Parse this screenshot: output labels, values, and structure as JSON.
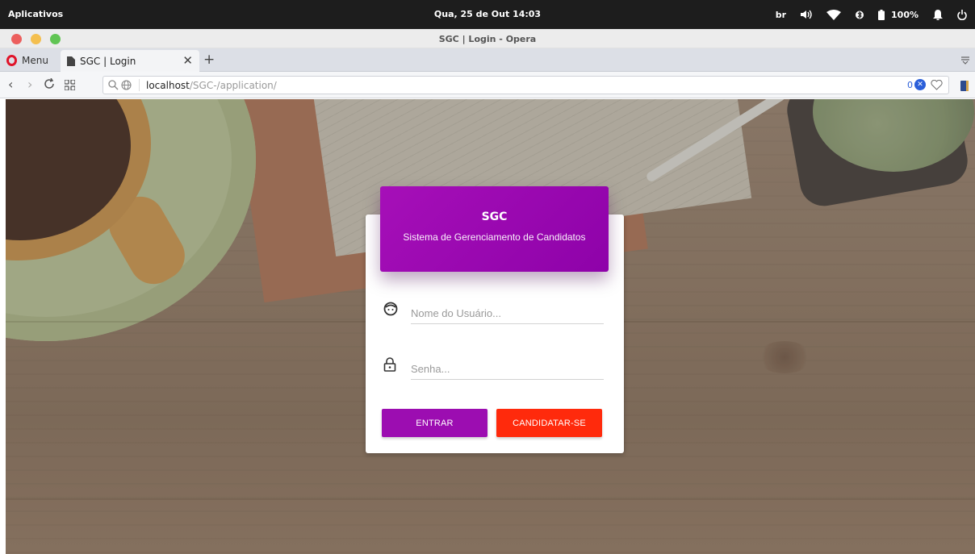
{
  "topbar": {
    "activities": "Aplicativos",
    "clock": "Qua, 25 de Out  14:03",
    "keyboard_layout": "br",
    "battery": "100%",
    "icons": [
      "volume-icon",
      "wifi-icon",
      "bluetooth-icon",
      "battery-icon",
      "notification-bell-icon",
      "power-icon"
    ]
  },
  "window": {
    "title": "SGC | Login - Opera",
    "controls": {
      "close_color": "#ec5f5d",
      "minimize_color": "#f4bf4f",
      "maximize_color": "#61c554"
    }
  },
  "browser": {
    "menu_label": "Menu",
    "tab": {
      "title": "SGC | Login"
    },
    "url": {
      "host": "localhost",
      "path": "/SGC-/application/"
    },
    "adblock_count": "0"
  },
  "login": {
    "brand": "SGC",
    "subtitle": "Sistema de Gerenciamento de Candidatos",
    "username": {
      "placeholder": "Nome do Usuário...",
      "value": ""
    },
    "password": {
      "placeholder": "Senha...",
      "value": ""
    },
    "enter_label": "ENTRAR",
    "apply_label": "CANDIDATAR-SE",
    "colors": {
      "primary": "#9c0db1",
      "danger": "#ff2a0c"
    }
  }
}
